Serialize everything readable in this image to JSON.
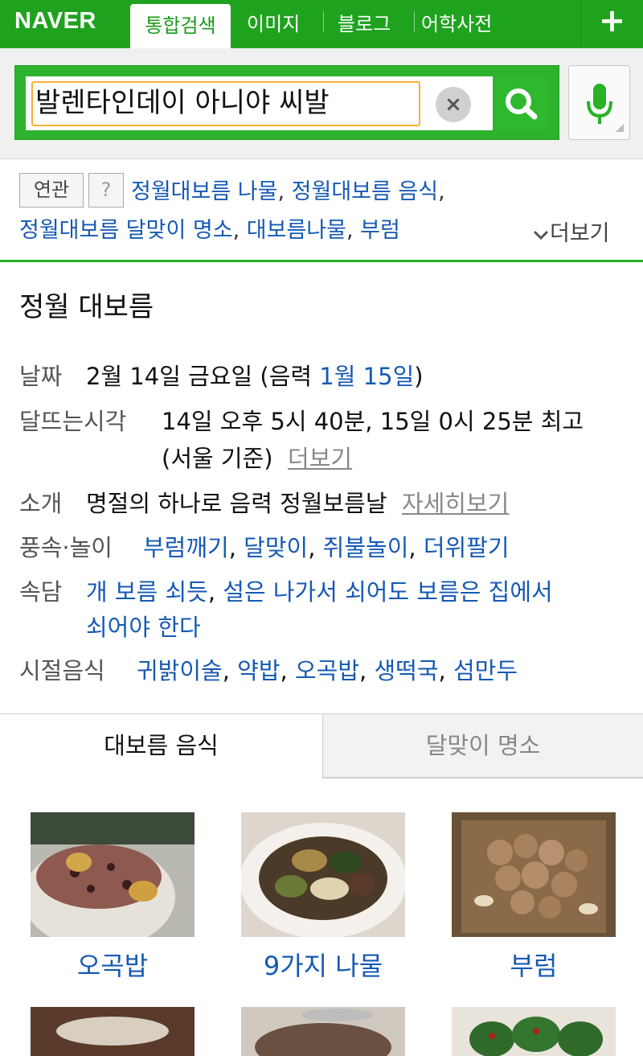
{
  "nav": {
    "logo": "NAVER",
    "tabs": [
      "통합검색",
      "이미지",
      "블로그",
      "어학사전"
    ],
    "plus": "+"
  },
  "search": {
    "query": "발렌타인데이 아니야 씨발",
    "clear": "×"
  },
  "related": {
    "label": "연관",
    "help": "?",
    "links": [
      "정월대보름 나물",
      "정월대보름 음식",
      "정월대보름 달맞이 명소",
      "대보름나물",
      "부럼"
    ],
    "more": "더보기"
  },
  "info": {
    "title": "정월 대보름",
    "date_label": "날짜",
    "date_value": "2월 14일 금요일 (음력 ",
    "date_lunar": "1월 15일",
    "date_close": ")",
    "moon_label": "달뜨는시각",
    "moon_value": "14일 오후 5시 40분, 15일 0시 25분 최고",
    "moon_value2": "(서울 기준)",
    "moon_more": "더보기",
    "intro_label": "소개",
    "intro_value": "명절의 하나로 음력 정월보름날",
    "intro_more": "자세히보기",
    "custom_label": "풍속·놀이",
    "customs": [
      "부럼깨기",
      "달맞이",
      "쥐불놀이",
      "더위팔기"
    ],
    "proverb_label": "속담",
    "proverb1": "개 보름 쇠듯",
    "proverb2a": "설은 나가서 쇠어도 보름은 집에서",
    "proverb2b": "쇠어야 한다",
    "food_label": "시절음식",
    "foods": [
      "귀밝이술",
      "약밥",
      "오곡밥",
      "생떡국",
      "섬만두"
    ]
  },
  "tabs": {
    "tab1": "대보름 음식",
    "tab2": "달맞이 명소"
  },
  "grid": {
    "items": [
      "오곡밥",
      "9가지 나물",
      "부럼"
    ]
  },
  "colors": {
    "naver_green": "#1fa31f",
    "link_blue": "#1659b4"
  }
}
